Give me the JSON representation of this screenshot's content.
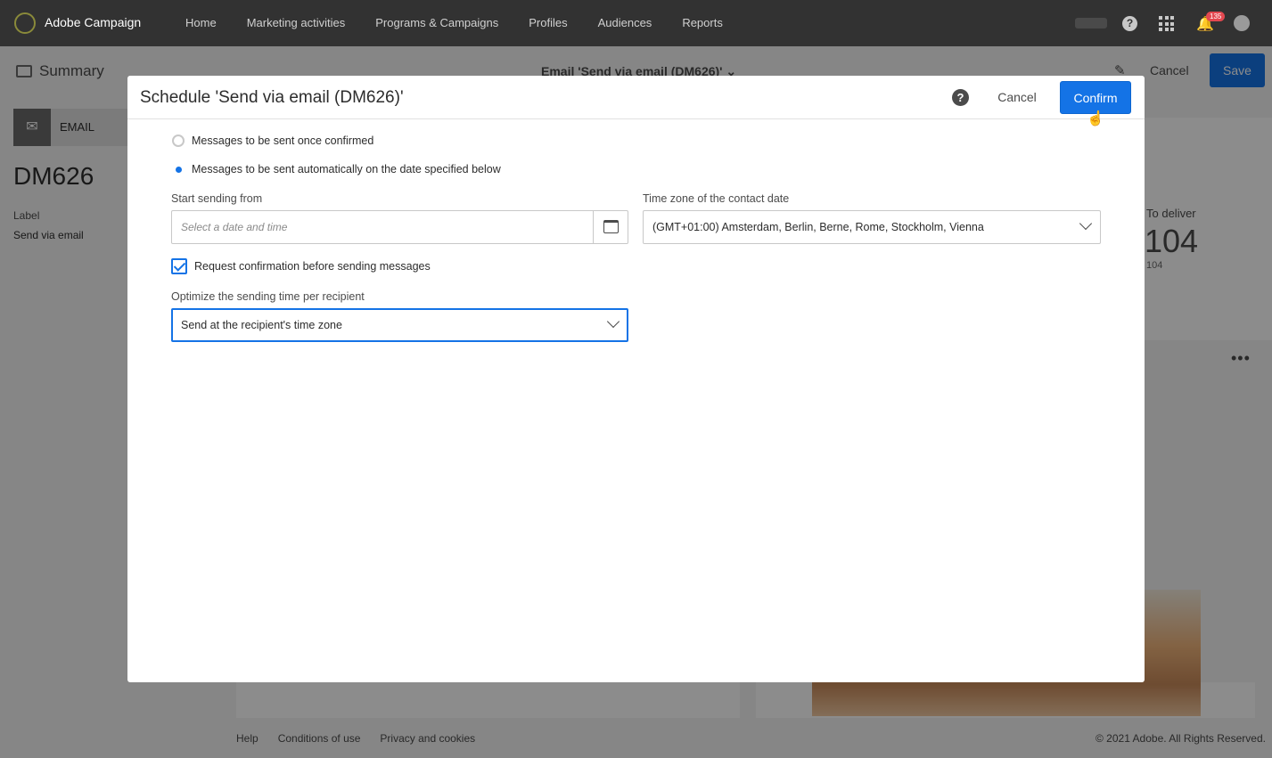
{
  "topbar": {
    "brand": "Adobe Campaign",
    "nav": [
      "Home",
      "Marketing activities",
      "Programs & Campaigns",
      "Profiles",
      "Audiences",
      "Reports"
    ],
    "notification_count": "135"
  },
  "background": {
    "summary_label": "Summary",
    "title": "Email 'Send via email (DM626)' ⌄",
    "cancel_label": "Cancel",
    "save_label": "Save",
    "channel_label": "EMAIL",
    "code": "DM626",
    "label_heading": "Label",
    "label_value": "Send via email",
    "to_deliver_label": "To deliver",
    "to_deliver_value": "104",
    "to_deliver_sub": "104",
    "footer_links": [
      "Help",
      "Conditions of use",
      "Privacy and cookies"
    ],
    "copyright": "© 2021 Adobe. All Rights Reserved."
  },
  "dialog": {
    "title": "Schedule 'Send via email (DM626)'",
    "cancel_label": "Cancel",
    "confirm_label": "Confirm",
    "radio_once": "Messages to be sent once confirmed",
    "radio_auto": "Messages to be sent automatically on the date specified below",
    "start_label": "Start sending from",
    "start_placeholder": "Select a date and time",
    "start_value": "",
    "timezone_label": "Time zone of the contact date",
    "timezone_value": "(GMT+01:00) Amsterdam, Berlin, Berne, Rome, Stockholm, Vienna",
    "confirm_checkbox_label": "Request confirmation before sending messages",
    "confirm_checkbox_checked": true,
    "optimize_label": "Optimize the sending time per recipient",
    "optimize_value": "Send at the recipient's time zone"
  },
  "colors": {
    "accent": "#1473e6",
    "topbar": "#323232"
  }
}
